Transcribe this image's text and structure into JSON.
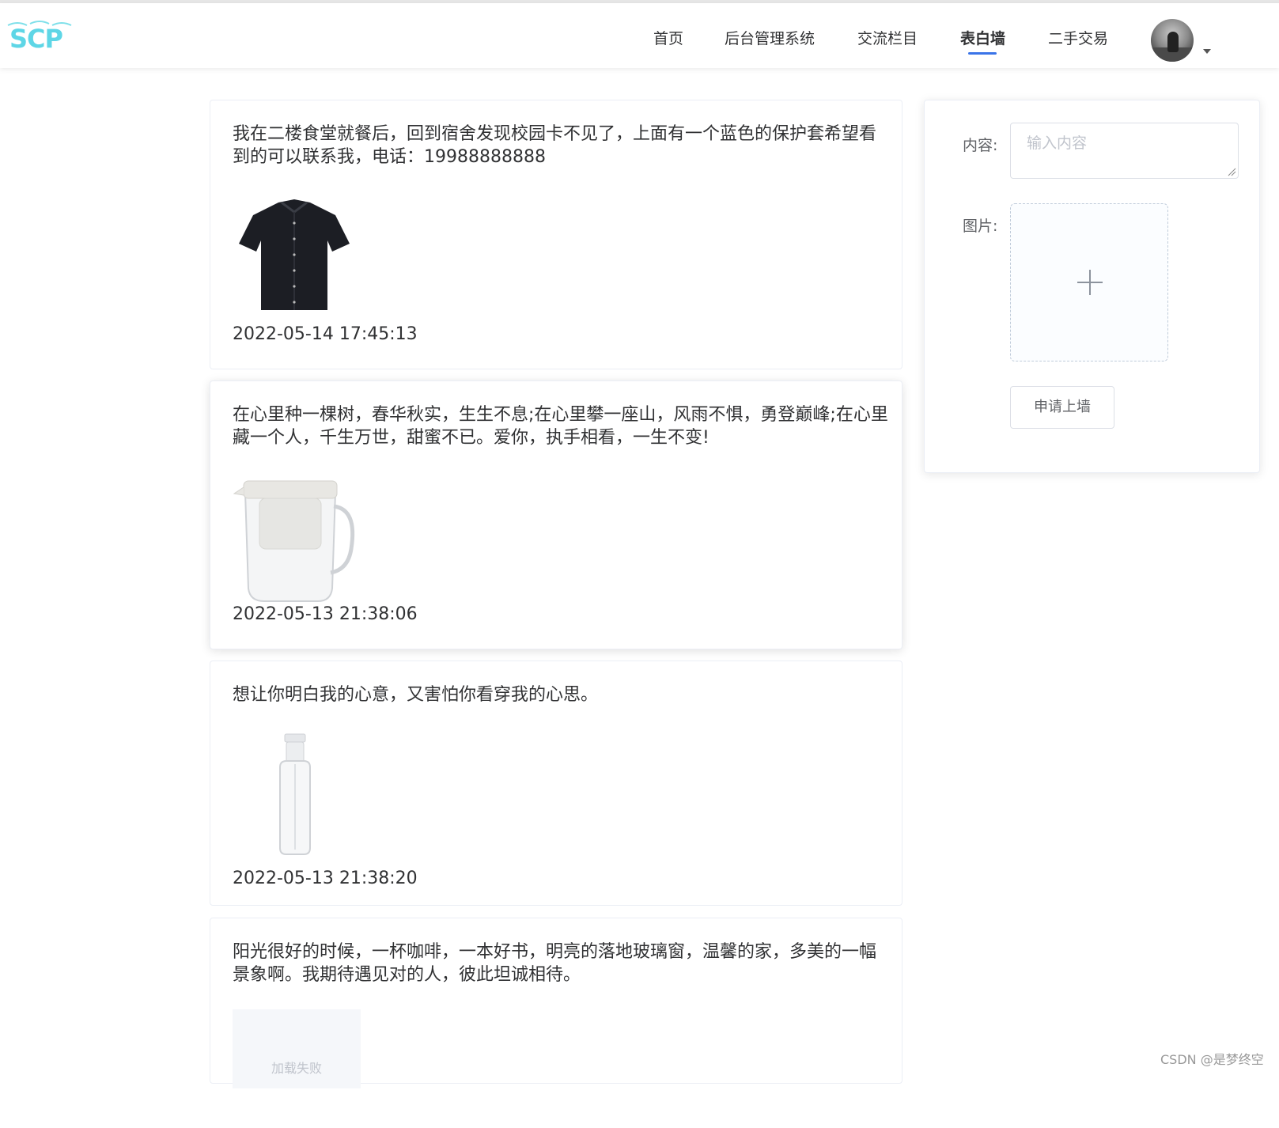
{
  "header": {
    "logo_text": "SCP",
    "nav": [
      "首页",
      "后台管理系统",
      "交流栏目",
      "表白墙",
      "二手交易"
    ],
    "active_nav": "表白墙"
  },
  "posts": [
    {
      "text": "我在二楼食堂就餐后，回到宿舍发现校园卡不见了，上面有一个蓝色的保护套希望看到的可以联系我，电话：19988888888",
      "image": "black-shirt",
      "time": "2022-05-14 17:45:13"
    },
    {
      "text": "在心里种一棵树，春华秋实，生生不息;在心里攀一座山，风雨不惧，勇登巅峰;在心里藏一个人，千生万世，甜蜜不已。爱你，执手相看，一生不变!",
      "image": "glass-teapot",
      "time": "2022-05-13 21:38:06"
    },
    {
      "text": "想让你明白我的心意，又害怕你看穿我的心思。",
      "image": "spray-bottle",
      "time": "2022-05-13 21:38:20"
    },
    {
      "text": "阳光很好的时候，一杯咖啡，一本好书，明亮的落地玻璃窗，温馨的家，多美的一幅景象啊。我期待遇见对的人，彼此坦诚相待。",
      "image_status": "加载失败"
    }
  ],
  "form": {
    "content_label": "内容:",
    "content_placeholder": "输入内容",
    "image_label": "图片:",
    "submit_label": "申请上墙"
  },
  "watermark": "CSDN @是梦终空",
  "colors": {
    "accent": "#3a74e8",
    "logo": "#5ed6e6"
  }
}
